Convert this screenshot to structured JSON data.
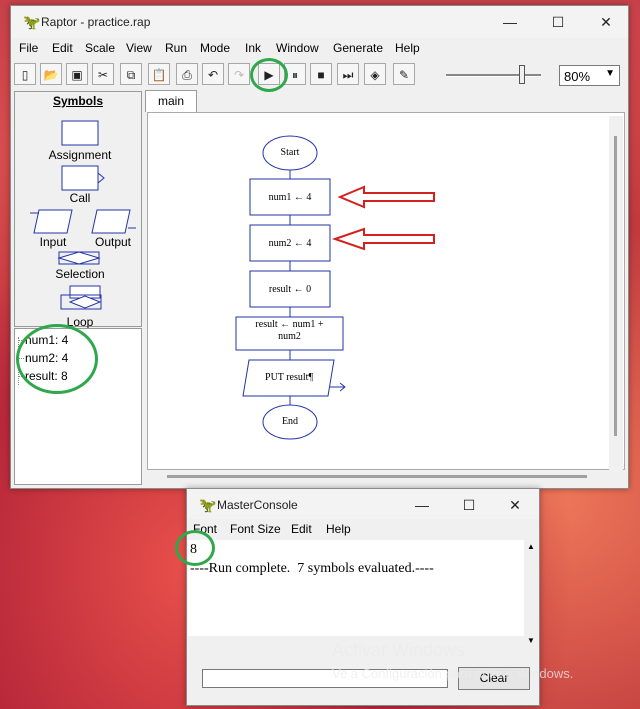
{
  "raptor": {
    "title": "Raptor - practice.rap",
    "menu": [
      "File",
      "Edit",
      "Scale",
      "View",
      "Run",
      "Mode",
      "Ink",
      "Window",
      "Generate",
      "Help"
    ],
    "zoom": "80%",
    "zoom_slider_level_pct": 85,
    "symbols_title": "Symbols",
    "symbols": [
      "Assignment",
      "Call",
      "Input",
      "Output",
      "Selection",
      "Loop"
    ],
    "variables": [
      "num1: 4",
      "num2: 4",
      "result: 8"
    ],
    "tab": "main",
    "flowchart": {
      "start": "Start",
      "steps": [
        "num1 ← 4",
        "num2 ← 4",
        "result ← 0",
        "result ← num1 +\nnum2",
        "PUT result¶"
      ],
      "end": "End"
    }
  },
  "console": {
    "title": "MasterConsole",
    "menu": [
      "Font",
      "Font Size",
      "Edit",
      "Help"
    ],
    "output_lines": [
      "8",
      "----Run complete.  7 symbols evaluated.----"
    ],
    "clear_label": "Clear"
  },
  "watermark": {
    "line1": "Activar Windows",
    "line2": "Ve a Configuración para activar Windows."
  },
  "colors": {
    "highlight_ring": "#2ea84a",
    "arrow": "#d42020",
    "flow_shape": "#2233aa"
  }
}
